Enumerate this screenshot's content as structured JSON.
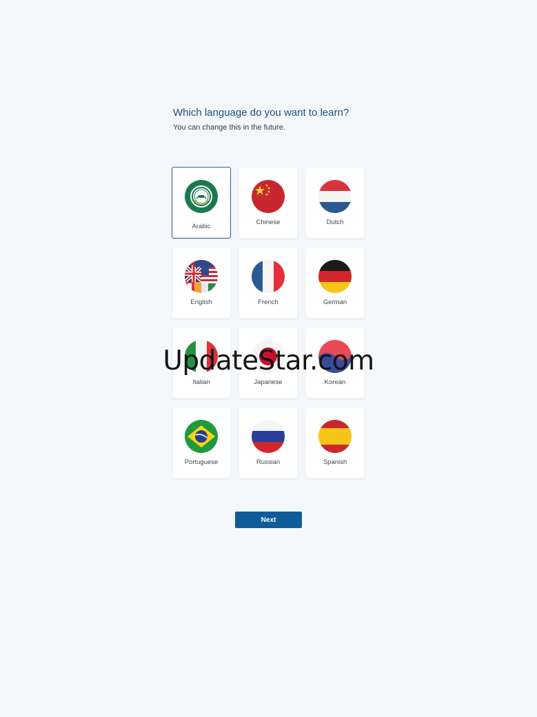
{
  "header": {
    "title": "Which language do you want to learn?",
    "subtitle": "You can change this in the future."
  },
  "languages": [
    {
      "label": "Arabic",
      "selected": true
    },
    {
      "label": "Chinese"
    },
    {
      "label": "Dutch"
    },
    {
      "label": "English"
    },
    {
      "label": "French"
    },
    {
      "label": "German"
    },
    {
      "label": "Italian"
    },
    {
      "label": "Japanese"
    },
    {
      "label": "Korean"
    },
    {
      "label": "Portuguese"
    },
    {
      "label": "Russian"
    },
    {
      "label": "Spanish"
    }
  ],
  "next_button": {
    "label": "Next"
  },
  "watermark": {
    "text": "UpdateStar.com"
  },
  "colors": {
    "background": "#f4f7fa",
    "accent": "#0f5c9a",
    "title": "#1c4f7c",
    "selected_border": "#2b5fa3"
  }
}
